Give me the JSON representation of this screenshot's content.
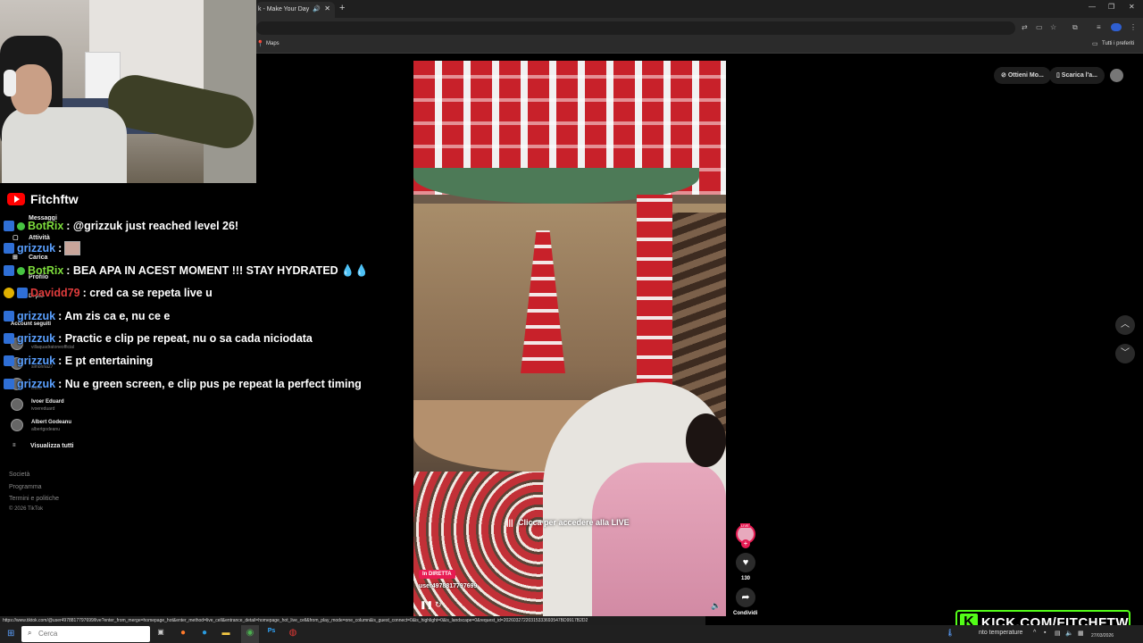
{
  "browser": {
    "tab_title": "k - Make Your Day",
    "new_tab_icon": "+",
    "bookmarks": {
      "maps": "Maps",
      "all_bookmarks": "Tutti i preferiti"
    },
    "status_url": "https://www.tiktok.com/@user4978817797699/live?enter_from_merge=homepage_hot&enter_method=live_cell&entrance_detail=homepage_hot_live_cell&from_play_mode=one_column&is_guest_connect=0&is_highlight=0&is_landscape=0&request_id=20260327220315333693547BD9917B2D2"
  },
  "sidebar": {
    "items": [
      {
        "label": "Messaggi"
      },
      {
        "label": "Attività"
      },
      {
        "label": "Carica"
      },
      {
        "label": "Profilo"
      },
      {
        "label": "Di più"
      }
    ],
    "following_title": "Account seguiti",
    "following": [
      {
        "name": "",
        "handle": "villaquadratoneofficial"
      },
      {
        "name": "",
        "handle": "simonna27"
      },
      {
        "name": "",
        "handle": "lsdvb"
      },
      {
        "name": "Ivoer Eduard",
        "handle": "ivoereduard"
      },
      {
        "name": "Albert Godeanu",
        "handle": "albertgodeanu"
      }
    ],
    "see_all": "Visualizza tutti",
    "footer": [
      "Società",
      "Programma",
      "Termini e politiche",
      "© 2026 TikTok"
    ]
  },
  "chat": {
    "channel": "Fitchftw",
    "messages": [
      {
        "user": "BotRix",
        "text": ": @grizzuk just reached level 26!"
      },
      {
        "user": "grizzuk",
        "text": ":"
      },
      {
        "user": "BotRix",
        "text": ": BEA APA IN ACEST MOMENT !!! STAY HYDRATED"
      },
      {
        "user": "Davidd79",
        "text": ": cred ca se repeta live u"
      },
      {
        "user": "grizzuk",
        "text": ": Am zis ca e, nu ce e"
      },
      {
        "user": "grizzuk",
        "text": ": Practic e clip pe repeat, nu o sa cada niciodata"
      },
      {
        "user": "grizzuk",
        "text": ": E pt entertaining"
      },
      {
        "user": "grizzuk",
        "text": ": Nu e green screen, e clip pus pe repeat la perfect timing"
      }
    ],
    "drops": "💧💧"
  },
  "video": {
    "cta": "Clicca per accedere alla LIVE",
    "live_badge": "In DIRETTA",
    "username": "user4978817797699",
    "like_count": "130",
    "share_label": "Condividi",
    "live_tag": "LIVE"
  },
  "top_actions": {
    "get_coins": "Ottieni Mo...",
    "download_app": "Scarica l'a..."
  },
  "kick": {
    "logo_letter": "K",
    "url": "KICK.COM/FITCHFTW"
  },
  "taskbar": {
    "search_placeholder": "Cerca",
    "weather": "nto temperature",
    "date": "27/03/2026"
  },
  "colors": {
    "tiktok_pink": "#e81b53",
    "kick_green": "#53fc18",
    "youtube_red": "#ff0000"
  }
}
